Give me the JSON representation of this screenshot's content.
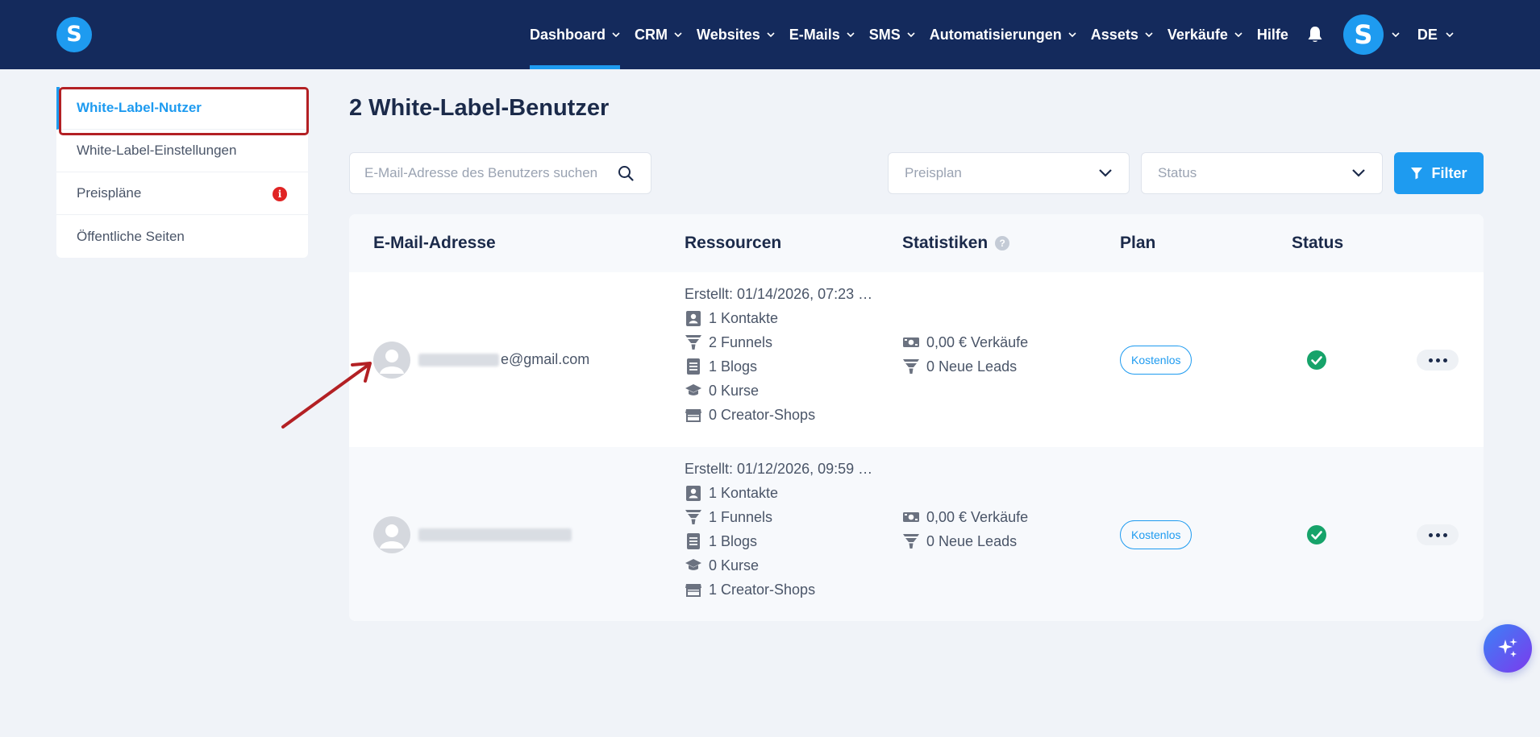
{
  "nav": {
    "logo": "S",
    "items": [
      {
        "label": "Dashboard",
        "has_chevron": true,
        "active": true
      },
      {
        "label": "CRM",
        "has_chevron": true
      },
      {
        "label": "Websites",
        "has_chevron": true
      },
      {
        "label": "E-Mails",
        "has_chevron": true
      },
      {
        "label": "SMS",
        "has_chevron": true
      },
      {
        "label": "Automatisierungen",
        "has_chevron": true
      },
      {
        "label": "Assets",
        "has_chevron": true
      },
      {
        "label": "Verkäufe",
        "has_chevron": true
      },
      {
        "label": "Hilfe",
        "has_chevron": false
      }
    ],
    "avatar": "S",
    "language": "DE"
  },
  "sidebar": {
    "items": [
      {
        "label": "White-Label-Nutzer",
        "active": true
      },
      {
        "label": "White-Label-Einstellungen"
      },
      {
        "label": "Preispläne",
        "badge": "i"
      },
      {
        "label": "Öffentliche Seiten"
      }
    ]
  },
  "main": {
    "title": "2 White-Label-Benutzer",
    "search": {
      "placeholder": "E-Mail-Adresse des Benutzers suchen",
      "value": ""
    },
    "plan_filter": {
      "placeholder": "Preisplan"
    },
    "status_filter": {
      "placeholder": "Status"
    },
    "filter_button": "Filter"
  },
  "table": {
    "headers": {
      "email": "E-Mail-Adresse",
      "resources": "Ressourcen",
      "stats": "Statistiken",
      "stats_help": "?",
      "plan": "Plan",
      "status": "Status"
    },
    "rows": [
      {
        "email_visible": "e@gmail.com",
        "created": "Erstellt: 01/14/2026, 07:23 …",
        "contacts": "1 Kontakte",
        "funnels": "2 Funnels",
        "blogs": "1 Blogs",
        "courses": "0 Kurse",
        "shops": "0 Creator-Shops",
        "sales": "0,00 € Verkäufe",
        "leads": "0 Neue Leads",
        "plan": "Kostenlos",
        "status": "active"
      },
      {
        "email_visible": "",
        "created": "Erstellt: 01/12/2026, 09:59 …",
        "contacts": "1 Kontakte",
        "funnels": "1 Funnels",
        "blogs": "1 Blogs",
        "courses": "0 Kurse",
        "shops": "1 Creator-Shops",
        "sales": "0,00 € Verkäufe",
        "leads": "0 Neue Leads",
        "plan": "Kostenlos",
        "status": "active"
      }
    ]
  },
  "colors": {
    "nav_bg": "#142a5c",
    "accent": "#1e9bf0",
    "success": "#16a36a",
    "alert": "#e02424",
    "highlight": "#b32024"
  }
}
